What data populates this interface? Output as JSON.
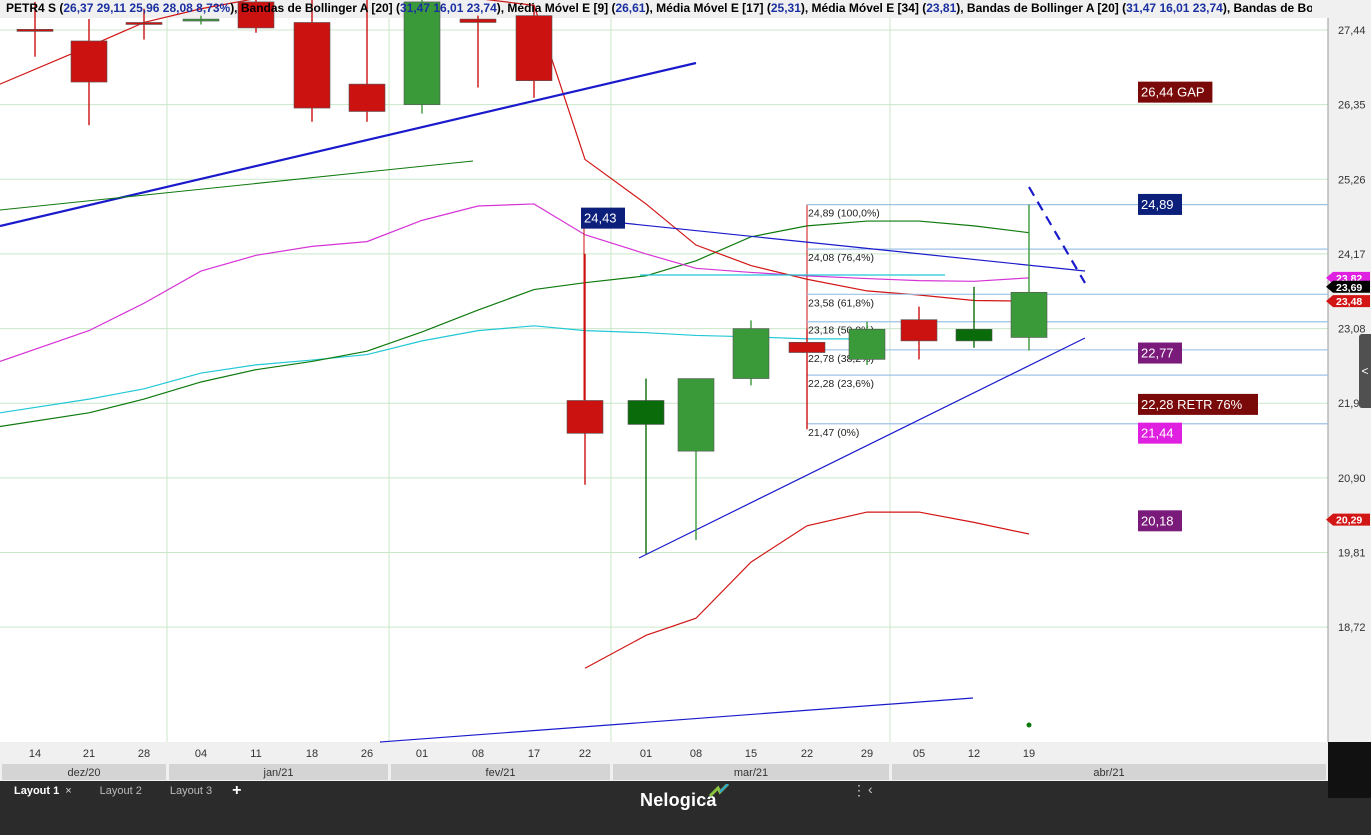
{
  "header": {
    "text_parts": [
      {
        "t": "PETR4 S (",
        "c": "k"
      },
      {
        "t": "26,37  29,11  25,96  28,08  8,73%",
        "c": "n"
      },
      {
        "t": "), Bandas de Bollinger A [20] (",
        "c": "k"
      },
      {
        "t": "31,47  16,01 23,74",
        "c": "n"
      },
      {
        "t": "), Média Móvel E [9] (",
        "c": "k"
      },
      {
        "t": "26,61",
        "c": "n"
      },
      {
        "t": "), Média Móvel E [17] (",
        "c": "k"
      },
      {
        "t": "25,31",
        "c": "n"
      },
      {
        "t": "), Média Móvel E [34] (",
        "c": "k"
      },
      {
        "t": "23,81",
        "c": "n"
      },
      {
        "t": "), Bandas de Bollinger A [20] (",
        "c": "k"
      },
      {
        "t": "31,47  16,01 23,74",
        "c": "n"
      },
      {
        "t": "), Bandas de Bol",
        "c": "k"
      }
    ]
  },
  "chart_data": {
    "type": "candlestick",
    "ticker": "PETR4",
    "y_ticks": [
      "27,44",
      "26,35",
      "25,26",
      "24,17",
      "23,08",
      "21,9",
      "20,90",
      "19,81",
      "18,72"
    ],
    "y_tick_values": [
      27.44,
      26.35,
      25.26,
      24.17,
      23.08,
      21.99,
      20.9,
      19.81,
      18.72
    ],
    "x_ticks": [
      "14",
      "21",
      "28",
      "04",
      "11",
      "18",
      "26",
      "01",
      "08",
      "17",
      "22",
      "01",
      "08",
      "15",
      "22",
      "29",
      "05",
      "12",
      "19"
    ],
    "months": [
      "dez/20",
      "jan/21",
      "fev/21",
      "mar/21",
      "abr/21"
    ],
    "candles": [
      {
        "x": "14",
        "o": 27.45,
        "h": 27.85,
        "l": 27.05,
        "c": 27.42
      },
      {
        "x": "21",
        "o": 27.28,
        "h": 27.6,
        "l": 26.05,
        "c": 26.68
      },
      {
        "x": "28",
        "o": 27.55,
        "h": 27.75,
        "l": 27.3,
        "c": 27.54
      },
      {
        "x": "04",
        "o": 27.6,
        "h": 27.65,
        "l": 27.52,
        "c": 27.6
      },
      {
        "x": "11",
        "o": 27.85,
        "h": 27.9,
        "l": 27.4,
        "c": 27.47
      },
      {
        "x": "18",
        "o": 27.55,
        "h": 27.95,
        "l": 26.1,
        "c": 26.3
      },
      {
        "x": "26",
        "o": 26.65,
        "h": 27.9,
        "l": 26.1,
        "c": 26.25
      },
      {
        "x": "01",
        "o": 26.35,
        "h": 27.9,
        "l": 26.22,
        "c": 27.85
      },
      {
        "x": "08",
        "o": 27.6,
        "h": 27.65,
        "l": 26.6,
        "c": 27.55
      },
      {
        "x": "17",
        "o": 27.65,
        "h": 27.8,
        "l": 26.45,
        "c": 26.7
      },
      {
        "x": "22",
        "o": 22.03,
        "h": 24.17,
        "l": 20.8,
        "c": 21.55
      },
      {
        "x": "01",
        "o": 21.68,
        "h": 22.35,
        "l": 19.79,
        "c": 22.03
      },
      {
        "x": "08",
        "o": 21.29,
        "h": 22.24,
        "l": 19.99,
        "c": 22.35
      },
      {
        "x": "15",
        "o": 22.35,
        "h": 23.2,
        "l": 22.25,
        "c": 23.08
      },
      {
        "x": "22",
        "o": 22.88,
        "h": 23.07,
        "l": 21.61,
        "c": 22.73
      },
      {
        "x": "29",
        "o": 22.63,
        "h": 23.18,
        "l": 22.55,
        "c": 23.07
      },
      {
        "x": "05",
        "o": 23.21,
        "h": 23.4,
        "l": 22.63,
        "c": 22.9
      },
      {
        "x": "12",
        "o": 22.9,
        "h": 23.69,
        "l": 22.8,
        "c": 23.07
      },
      {
        "x": "19",
        "o": 22.95,
        "h": 24.89,
        "l": 22.76,
        "c": 23.61
      }
    ],
    "ma_lines": {
      "ma9": {
        "color": "#d21515",
        "values": [
          26.65,
          27.2,
          27.55,
          27.75,
          27.9,
          27.92,
          27.92,
          27.95,
          27.9,
          27.8,
          25.55,
          24.9,
          24.3,
          24.0,
          23.8,
          23.63,
          23.57,
          23.49,
          23.48
        ]
      },
      "ma17": {
        "color": "#d633d6",
        "values": [
          22.6,
          23.05,
          23.45,
          23.92,
          24.15,
          24.28,
          24.35,
          24.66,
          24.87,
          24.9,
          24.45,
          24.17,
          23.96,
          23.9,
          23.85,
          23.81,
          23.78,
          23.77,
          23.82
        ]
      },
      "ma34": {
        "color": "#22c8d6",
        "values": [
          21.85,
          22.05,
          22.2,
          22.43,
          22.55,
          22.62,
          22.7,
          22.9,
          23.05,
          23.12,
          23.05,
          23.02,
          22.98,
          22.96,
          22.93,
          22.93,
          null,
          null,
          null
        ]
      },
      "bb_mid": {
        "color": "#0e7a0e",
        "values": [
          21.65,
          21.85,
          22.05,
          22.3,
          22.48,
          22.6,
          22.75,
          23.03,
          23.35,
          23.65,
          23.75,
          23.85,
          24.07,
          24.42,
          24.58,
          24.65,
          24.65,
          24.58,
          24.48
        ]
      },
      "bb_low": {
        "color": "#d21515",
        "values": [
          null,
          null,
          null,
          null,
          null,
          null,
          null,
          null,
          null,
          null,
          18.12,
          18.6,
          18.85,
          19.67,
          20.2,
          20.4,
          20.4,
          20.25,
          20.08
        ]
      }
    },
    "fib_levels": [
      {
        "label": "24,89 (100,0%)",
        "value": 24.89
      },
      {
        "label": "24,08 (76,4%)",
        "value": 24.24
      },
      {
        "label": "23,58 (61,8%)",
        "value": 23.58
      },
      {
        "label": "23,18 (50,0%)",
        "value": 23.18
      },
      {
        "label": "22,78 (38,2%)",
        "value": 22.77
      },
      {
        "label": "22,28 (23,6%)",
        "value": 22.4
      },
      {
        "label": "21,47 (0%)",
        "value": 21.69
      }
    ],
    "annotations": [
      {
        "text": "26,44 GAP",
        "bg": "#7a0a0a",
        "value": 26.54
      },
      {
        "text": "24,89",
        "bg": "#0c1f7a",
        "value": 24.9
      },
      {
        "text": "22,77",
        "bg": "#7a1a7a",
        "value": 22.73
      },
      {
        "text": "22,28  RETR 76%",
        "bg": "#7a0a0a",
        "value": 21.98
      },
      {
        "text": "21,44",
        "bg": "#e020e0",
        "value": 21.56
      },
      {
        "text": "20,18",
        "bg": "#7a1a7a",
        "value": 20.28
      },
      {
        "text": "24,43",
        "bg": "#0c1f7a",
        "value": 24.7
      }
    ],
    "price_tags": [
      {
        "text": "23,82",
        "bg": "#e020e0",
        "value": 23.82
      },
      {
        "text": "23,69",
        "bg": "#000000",
        "value": 23.69
      },
      {
        "text": "23,48",
        "bg": "#d21515",
        "value": 23.48
      },
      {
        "text": "20,29",
        "bg": "#d21515",
        "value": 20.29
      }
    ],
    "colors": {
      "up": "#3a9a3a",
      "down": "#cc1111",
      "up_dark": "#0a6b0a",
      "grid": "#c9e7c9",
      "trend": "#1a1acc"
    }
  },
  "tabs": [
    {
      "label": "Layout 1",
      "active": true
    },
    {
      "label": "Layout 2",
      "active": false
    },
    {
      "label": "Layout 3",
      "active": false
    }
  ],
  "brand": "Nelogica",
  "add_tab_symbol": "+"
}
